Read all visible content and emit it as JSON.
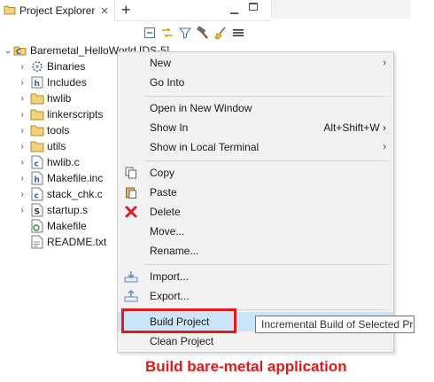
{
  "view": {
    "tab_title": "Project Explorer",
    "close_glyph": "✕",
    "plus_glyph": "+",
    "minimize_glyph": "▭"
  },
  "toolbar": {
    "icons": [
      "collapse-all-icon",
      "link-with-editor-icon",
      "filter-icon",
      "build-hammer-icon",
      "clean-broom-icon",
      "view-menu-icon"
    ]
  },
  "tree": {
    "root": "Baremetal_HelloWorld [DS-5]",
    "items": [
      {
        "label": "Binaries",
        "icon": "binaries-icon",
        "chevron": "›"
      },
      {
        "label": "Includes",
        "icon": "includes-icon",
        "chevron": "›"
      },
      {
        "label": "hwlib",
        "icon": "folder-icon",
        "chevron": "›"
      },
      {
        "label": "linkerscripts",
        "icon": "folder-icon",
        "chevron": "›"
      },
      {
        "label": "tools",
        "icon": "folder-icon",
        "chevron": "›"
      },
      {
        "label": "utils",
        "icon": "folder-icon",
        "chevron": "›"
      },
      {
        "label": "hwlib.c",
        "icon": "c-file-icon",
        "chevron": "›"
      },
      {
        "label": "Makefile.inc",
        "icon": "h-file-icon",
        "chevron": "›"
      },
      {
        "label": "stack_chk.c",
        "icon": "c-file-icon",
        "chevron": "›"
      },
      {
        "label": "startup.s",
        "icon": "s-file-icon",
        "chevron": "›"
      },
      {
        "label": "Makefile",
        "icon": "makefile-icon",
        "chevron": ""
      },
      {
        "label": "README.txt",
        "icon": "text-file-icon",
        "chevron": ""
      }
    ]
  },
  "menu": {
    "items": {
      "new": {
        "label": "New",
        "submenu": "›"
      },
      "go_into": {
        "label": "Go Into"
      },
      "open_new_window": {
        "label": "Open in New Window"
      },
      "show_in": {
        "label": "Show In",
        "accel": "Alt+Shift+W ›"
      },
      "show_terminal": {
        "label": "Show in Local Terminal",
        "submenu": "›"
      },
      "copy": {
        "label": "Copy"
      },
      "paste": {
        "label": "Paste"
      },
      "delete": {
        "label": "Delete"
      },
      "move": {
        "label": "Move..."
      },
      "rename": {
        "label": "Rename..."
      },
      "import": {
        "label": "Import..."
      },
      "export": {
        "label": "Export..."
      },
      "build_project": {
        "label": "Build Project"
      },
      "clean_project": {
        "label": "Clean Project"
      }
    }
  },
  "tooltip": {
    "text": "Incremental Build of Selected Pr"
  },
  "caption": {
    "text": "Build bare-metal application"
  },
  "colors": {
    "highlight_red": "#e01919",
    "selection_blue": "#cce4f7",
    "menu_bg": "#f2f2f2"
  }
}
